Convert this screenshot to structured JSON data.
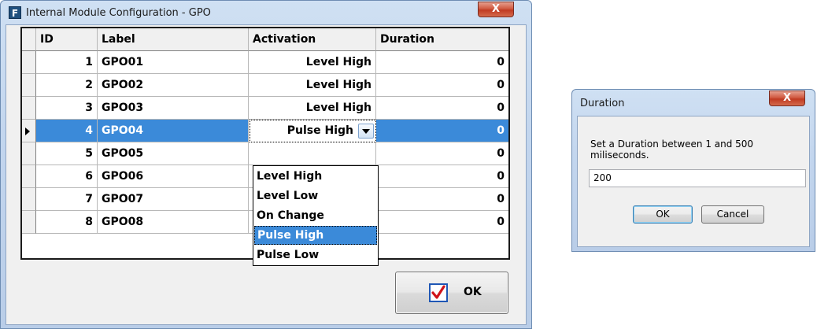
{
  "main_window": {
    "app_icon_letter": "F",
    "title": "Internal Module Configuration - GPO",
    "close_glyph": "X",
    "grid": {
      "columns": [
        "ID",
        "Label",
        "Activation",
        "Duration"
      ],
      "rows": [
        {
          "id": "1",
          "label": "GPO01",
          "activation": "Level High",
          "duration": "0"
        },
        {
          "id": "2",
          "label": "GPO02",
          "activation": "Level High",
          "duration": "0"
        },
        {
          "id": "3",
          "label": "GPO03",
          "activation": "Level High",
          "duration": "0"
        },
        {
          "id": "4",
          "label": "GPO04",
          "activation": "Pulse High",
          "duration": "0"
        },
        {
          "id": "5",
          "label": "GPO05",
          "activation": "",
          "duration": "0"
        },
        {
          "id": "6",
          "label": "GPO06",
          "activation": "",
          "duration": "0"
        },
        {
          "id": "7",
          "label": "GPO07",
          "activation": "",
          "duration": "0"
        },
        {
          "id": "8",
          "label": "GPO08",
          "activation": "",
          "duration": "0"
        }
      ],
      "selected_row_index": 3
    },
    "activation_dropdown": {
      "options": [
        "Level High",
        "Level Low",
        "On Change",
        "Pulse High",
        "Pulse Low"
      ],
      "highlighted": "Pulse High"
    },
    "ok_button": {
      "label": "OK",
      "icon": "checkbox-checked-icon"
    }
  },
  "duration_dialog": {
    "title": "Duration",
    "close_glyph": "X",
    "message": "Set a Duration between 1 and 500 miliseconds.",
    "input_value": "200",
    "ok_label": "OK",
    "cancel_label": "Cancel"
  },
  "colors": {
    "selection": "#3b8ad9",
    "title_bar": "#c3d6ee",
    "close_button": "#c13b22"
  }
}
